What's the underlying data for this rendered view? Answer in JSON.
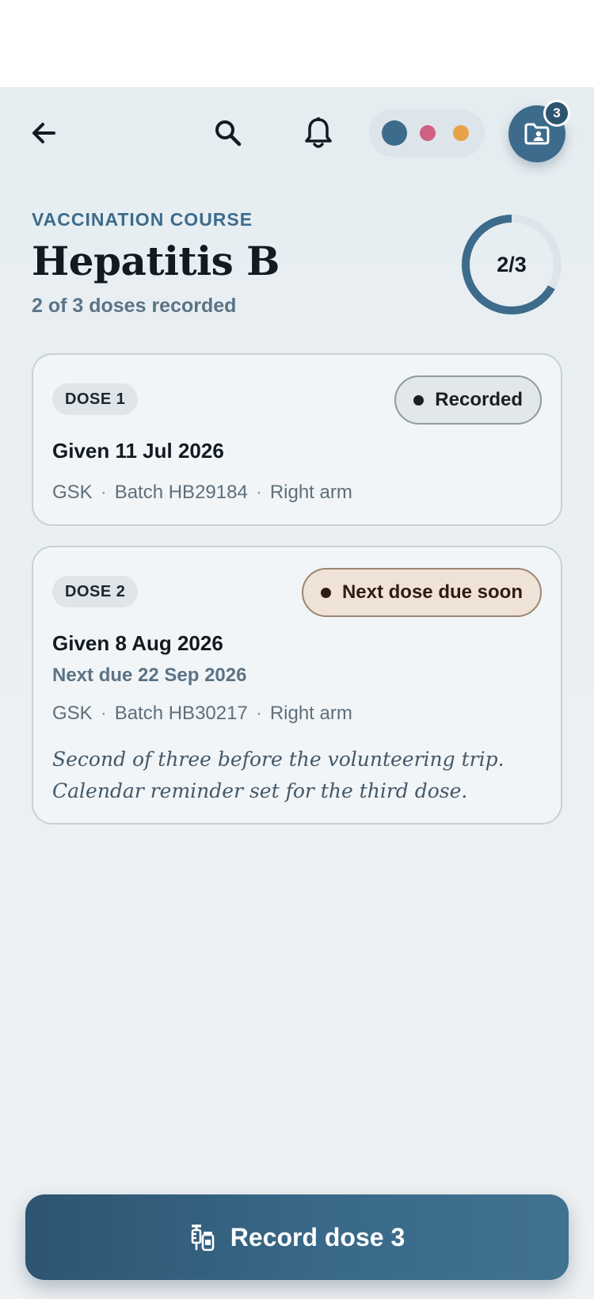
{
  "header": {
    "eyebrow": "VACCINATION COURSE",
    "title": "Hepatitis B",
    "subtitle": "2 of 3 doses recorded",
    "progress_label": "2/3",
    "progress_fraction": 0.6667
  },
  "topbar": {
    "icons": [
      "back-arrow-icon",
      "search-icon",
      "bell-icon",
      "folder-person-icon"
    ],
    "records_count": "3",
    "theme_colors": [
      "#3d6b8c",
      "#d06184",
      "#e7a24a"
    ]
  },
  "doses": [
    {
      "chip": "DOSE 1",
      "status": "Recorded",
      "given": "Given 11 Jul 2026",
      "next_due": "",
      "maker": "GSK",
      "batch": "Batch HB29184",
      "site": "Right arm",
      "note": ""
    },
    {
      "chip": "DOSE 2",
      "status": "Next dose due soon",
      "given": "Given 8 Aug 2026",
      "next_due": "Next due 22 Sep 2026",
      "maker": "GSK",
      "batch": "Batch HB30217",
      "site": "Right arm",
      "note": "Second of three before the volunteering trip. Calendar reminder set for the third dose."
    }
  ],
  "actions": {
    "primary_label": "Record dose 3",
    "primary_icon": "syringe-vial-icon"
  },
  "colors": {
    "accent": "#3d6b8c",
    "due_badge_bg": "#efe3d7"
  }
}
